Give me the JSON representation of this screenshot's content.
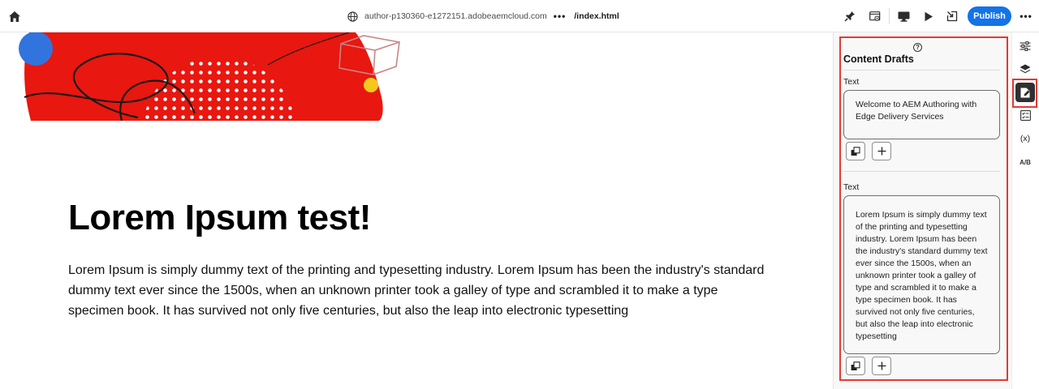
{
  "topbar": {
    "host": "author-p130360-e1272151.adobeaemcloud.com",
    "more": "•••",
    "path": "/index.html",
    "publish_label": "Publish",
    "right_more": "•••"
  },
  "page": {
    "title": "Lorem Ipsum test!",
    "body": "Lorem Ipsum is simply dummy text of the printing and typesetting industry. Lorem Ipsum has been the industry's standard dummy text ever since the 1500s, when an unknown printer took a galley of type and scrambled it to make a type specimen book. It has survived not only five centuries, but also the leap into electronic typesetting"
  },
  "panel": {
    "help": "?",
    "title": "Content Drafts",
    "drafts": [
      {
        "label": "Text",
        "text": "Welcome to AEM Authoring with Edge Delivery Services"
      },
      {
        "label": "Text",
        "text": "Lorem Ipsum is simply dummy text of the printing and typesetting industry. Lorem Ipsum has been the industry's standard dummy text ever since the 1500s, when an unknown printer took a galley of type and scrambled it to make a type specimen book. It has survived not only five centuries, but also the leap into electronic typesetting"
      }
    ]
  },
  "rail": {
    "variables_label": "(x)",
    "ab_label": "A/B"
  },
  "colors": {
    "accent": "#1473e6",
    "highlight": "#e33a32",
    "hero_red": "#e8170f"
  }
}
